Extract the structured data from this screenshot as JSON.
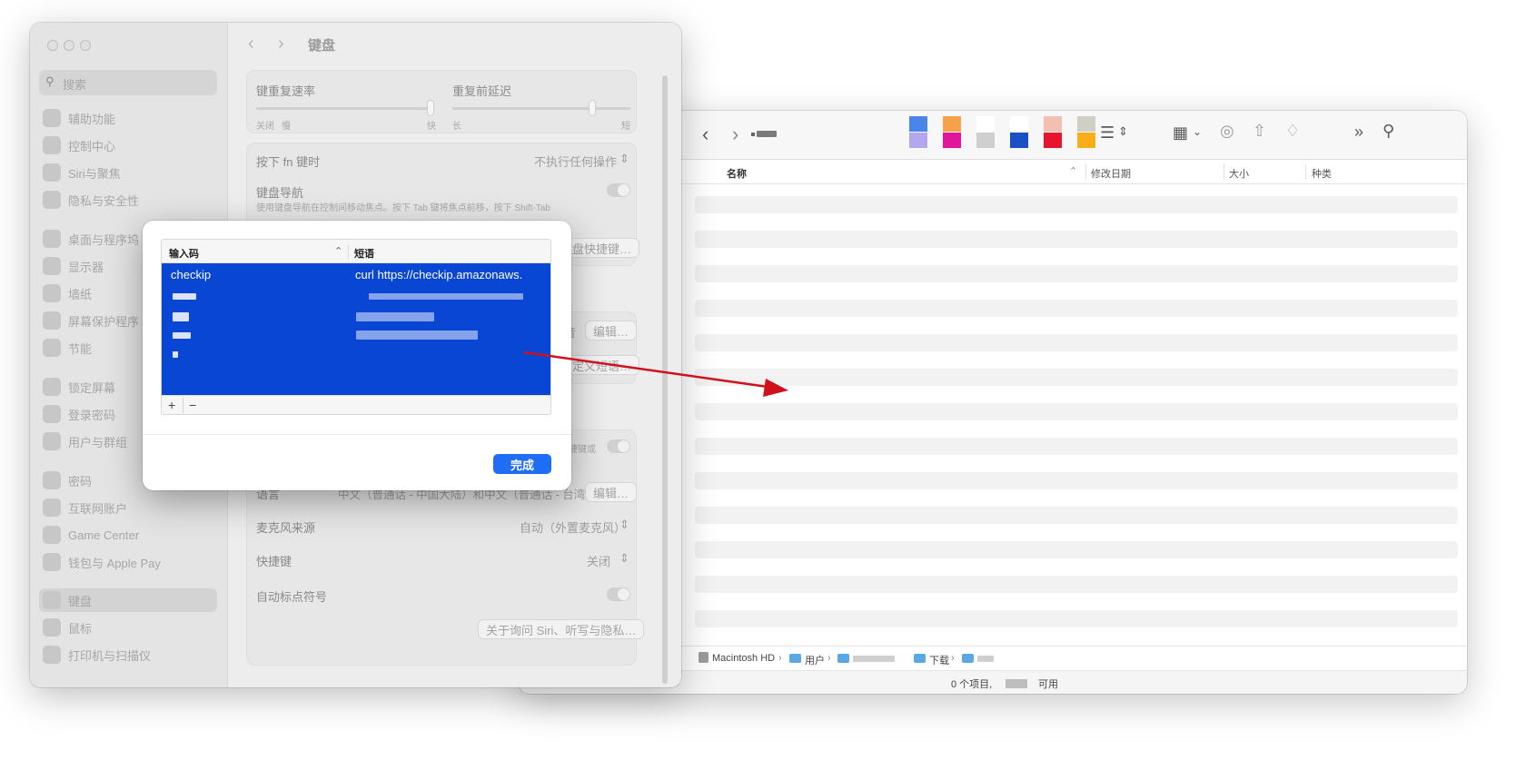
{
  "settings": {
    "title": "键盘",
    "search_placeholder": "搜索",
    "sidebar": [
      "辅助功能",
      "控制中心",
      "Siri与聚焦",
      "隐私与安全性",
      "桌面与程序坞",
      "显示器",
      "墙纸",
      "屏幕保护程序",
      "节能",
      "锁定屏幕",
      "登录密码",
      "用户与群组",
      "密码",
      "互联网账户",
      "Game Center",
      "钱包与 Apple Pay",
      "键盘",
      "鼠标",
      "打印机与扫描仪"
    ],
    "repeat_rate_label": "键重复速率",
    "repeat_delay_label": "重复前延迟",
    "rate_left": "关闭",
    "rate_slow": "慢",
    "rate_fast": "快",
    "delay_long": "长",
    "delay_short": "短",
    "fn_label": "按下 fn 键时",
    "fn_value": "不执行任何操作",
    "nav_label": "键盘导航",
    "nav_desc": "使用键盘导航在控制间移动焦点。按下 Tab 键将焦点前移，按下 Shift-Tab",
    "shortcuts_button": "键盘快捷键…",
    "input_source_value": "拼音",
    "edit_button": "编辑…",
    "custom_phrase_button": "自定义短语…",
    "dictation_shortcut_hint": "用快捷键或",
    "language_label": "语言",
    "language_value": "中文（普通话 - 中国大陆）和中文（普通话 - 台湾）",
    "language_edit_button": "编辑…",
    "mic_label": "麦克风来源",
    "mic_value": "自动（外置麦克风）",
    "shortcut_label": "快捷键",
    "shortcut_value": "关闭",
    "auto_punct_label": "自动标点符号",
    "about_button": "关于询问 Siri、听写与隐私…"
  },
  "dialog": {
    "col_input": "输入码",
    "col_phrase": "短语",
    "row1_input": "checkip",
    "row1_phrase": "curl https://checkip.amazonaws.",
    "add": "+",
    "remove": "−",
    "done_button": "完成"
  },
  "finder": {
    "columns": {
      "name": "名称",
      "date": "修改日期",
      "size": "大小",
      "kind": "种类"
    },
    "tag_colors": [
      [
        "#4a86e8",
        "#b4a7f0"
      ],
      [
        "#f6a24a",
        "#e0169b"
      ],
      [
        "#ffffff",
        "#cfcfcf"
      ],
      [
        "#ffffff",
        "#1a4fc6"
      ],
      [
        "#f3bfb0",
        "#e8132f"
      ],
      [
        "#cfcfc4",
        "#f9ad19"
      ]
    ],
    "path": [
      "Macintosh HD",
      "用户",
      "下载"
    ],
    "status_items": "0 个项目,",
    "status_available": "可用"
  },
  "arrow_color": "#d0101b"
}
